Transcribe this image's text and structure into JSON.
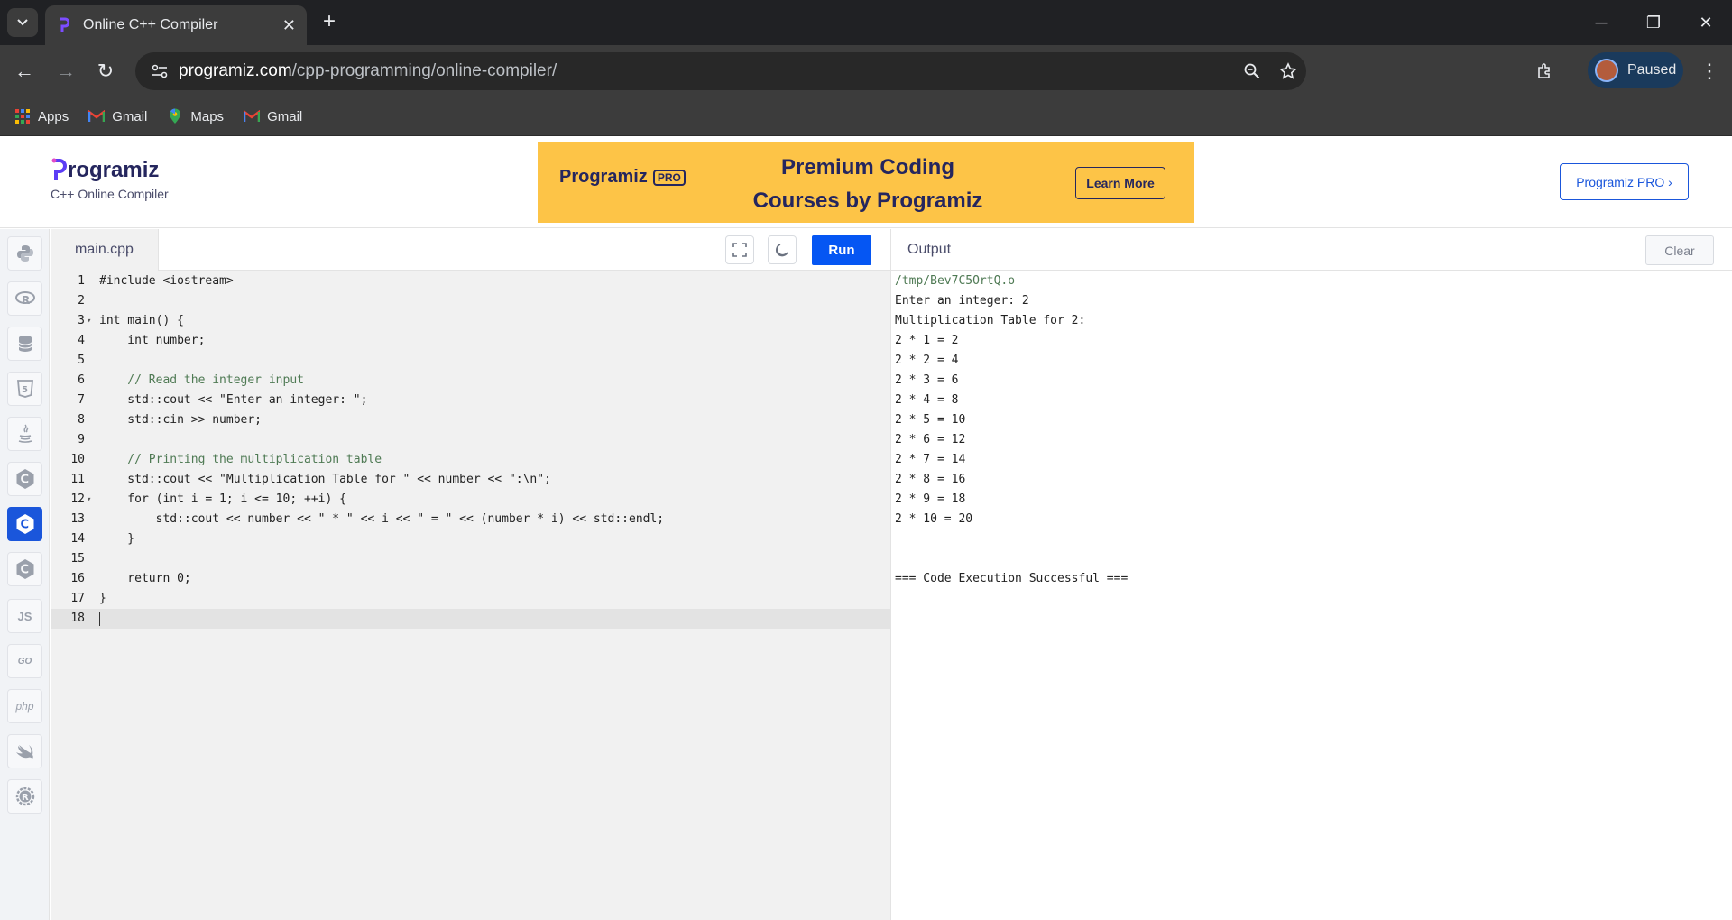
{
  "browser": {
    "tab_title": "Online C++ Compiler",
    "url_host": "programiz.com",
    "url_path": "/cpp-programming/online-compiler/",
    "profile_label": "Paused",
    "bookmarks": [
      {
        "label": "Apps",
        "icon": "apps-grid-icon"
      },
      {
        "label": "Gmail",
        "icon": "gmail-icon"
      },
      {
        "label": "Maps",
        "icon": "maps-pin-icon"
      },
      {
        "label": "Gmail",
        "icon": "gmail-icon"
      }
    ]
  },
  "header": {
    "logo_text": "rogramiz",
    "subtitle": "C++ Online Compiler",
    "banner": {
      "logo_text": "Programiz",
      "pro_badge": "PRO",
      "title_line1": "Premium Coding",
      "title_line2": "Courses by Programiz",
      "cta": "Learn More"
    },
    "pro_button": "Programiz PRO ›"
  },
  "languages": [
    {
      "name": "python-icon",
      "label": "",
      "active": false
    },
    {
      "name": "r-icon",
      "label": "R",
      "active": false
    },
    {
      "name": "sql-icon",
      "label": "",
      "active": false
    },
    {
      "name": "html-icon",
      "label": "5",
      "active": false
    },
    {
      "name": "java-icon",
      "label": "",
      "active": false
    },
    {
      "name": "c-icon",
      "label": "C",
      "active": false
    },
    {
      "name": "cpp-icon",
      "label": "C",
      "active": true
    },
    {
      "name": "csharp-icon",
      "label": "C",
      "active": false
    },
    {
      "name": "javascript-icon",
      "label": "JS",
      "active": false
    },
    {
      "name": "go-icon",
      "label": "GO",
      "active": false
    },
    {
      "name": "php-icon",
      "label": "php",
      "active": false
    },
    {
      "name": "swift-icon",
      "label": "",
      "active": false
    },
    {
      "name": "rust-icon",
      "label": "R",
      "active": false
    }
  ],
  "editor": {
    "file_name": "main.cpp",
    "run_label": "Run",
    "current_line": 18,
    "lines": [
      "#include <iostream>",
      "",
      "int main() {",
      "    int number;",
      "",
      "    // Read the integer input",
      "    std::cout << \"Enter an integer: \";",
      "    std::cin >> number;",
      "",
      "    // Printing the multiplication table",
      "    std::cout << \"Multiplication Table for \" << number << \":\\n\";",
      "    for (int i = 1; i <= 10; ++i) {",
      "        std::cout << number << \" * \" << i << \" = \" << (number * i) << std::endl;",
      "    }",
      "",
      "    return 0;",
      "}",
      ""
    ],
    "fold_lines": [
      3,
      12
    ]
  },
  "output": {
    "title": "Output",
    "clear_label": "Clear",
    "lines": [
      "/tmp/Bev7C5OrtQ.o",
      "Enter an integer: 2",
      "Multiplication Table for 2:",
      "2 * 1 = 2",
      "2 * 2 = 4",
      "2 * 3 = 6",
      "2 * 4 = 8",
      "2 * 5 = 10",
      "2 * 6 = 12",
      "2 * 7 = 14",
      "2 * 8 = 16",
      "2 * 9 = 18",
      "2 * 10 = 20",
      "",
      "",
      "=== Code Execution Successful ==="
    ]
  }
}
